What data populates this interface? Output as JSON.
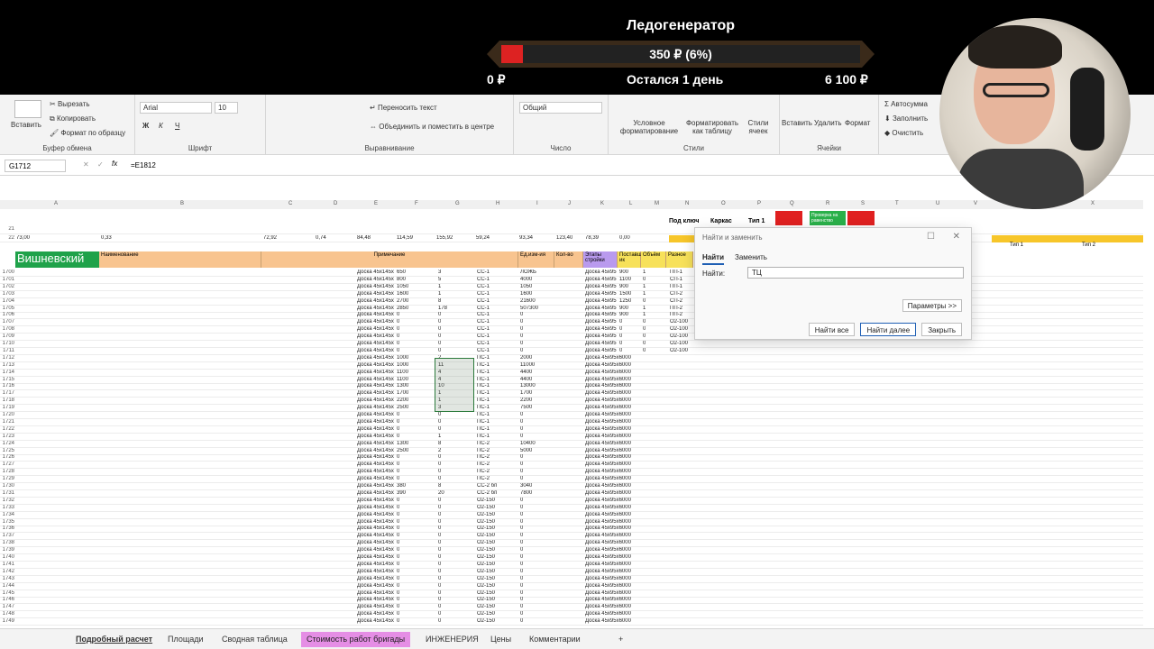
{
  "stream": {
    "title": "Ледогенератор",
    "progress_label": "350 ₽ (6%)",
    "progress_fraction": 0.06,
    "min_label": "0 ₽",
    "remaining_label": "Остался 1 день",
    "max_label": "6 100 ₽"
  },
  "ribbon": {
    "clipboard": {
      "paste": "Вставить",
      "cut": "Вырезать",
      "copy": "Копировать",
      "format_painter": "Формат по образцу",
      "label": "Буфер обмена"
    },
    "font": {
      "name": "Arial",
      "size": "10",
      "bold": "Ж",
      "italic": "К",
      "underline": "Ч",
      "label": "Шрифт"
    },
    "alignment": {
      "wrap": "Переносить текст",
      "merge": "Объединить и поместить в центре",
      "label": "Выравнивание"
    },
    "number": {
      "format": "Общий",
      "label": "Число"
    },
    "styles": {
      "cond": "Условное форматирование",
      "table": "Форматировать как таблицу",
      "cell": "Стили ячеек",
      "label": "Стили"
    },
    "cells": {
      "insert": "Вставить",
      "delete": "Удалить",
      "format": "Формат",
      "label": "Ячейки"
    },
    "editing": {
      "autosum": "Автосумма",
      "fill": "Заполнить",
      "clear": "Очистить"
    }
  },
  "formula_bar": {
    "cell": "G1712",
    "formula": "=E1812"
  },
  "columns": [
    "A",
    "B",
    "C",
    "D",
    "E",
    "F",
    "G",
    "H",
    "I",
    "J",
    "K",
    "L",
    "M",
    "N",
    "O",
    "P",
    "Q",
    "R",
    "S",
    "T",
    "U",
    "V",
    "X"
  ],
  "summary": {
    "row22": [
      "73,00",
      "0,33",
      "72,92",
      "0,74",
      "84,48",
      "114,59",
      "155,92",
      "59,24",
      "93,34",
      "123,40",
      "78,39",
      "0,00"
    ],
    "headers": [
      "Под ключ",
      "Каркас",
      "Тип 1",
      "Проверка на равенство",
      "Тип 1",
      "Тип 2"
    ]
  },
  "sheet": {
    "section_title": "Вишневский",
    "col_name": "Наименование",
    "col_note": "Примечание",
    "col_unit": "Ед.изм-ия",
    "col_qty": "Кол-во",
    "col_stage": "Этапы стройки",
    "col_supplier": "Поставщ ик",
    "col_volume": "Объём",
    "col_misc": "Разное"
  },
  "rows": [
    {
      "n": "1700",
      "e": "Доска 45х145х",
      "f": "650",
      "g": "3",
      "h": "СС-1",
      "i": "ЛОЖЬ",
      "k": "Доска 45х95",
      "l": "900",
      "m": "1",
      "n2": "ПП-1"
    },
    {
      "n": "1701",
      "e": "Доска 45х145х",
      "f": "800",
      "g": "5",
      "h": "СС-1",
      "i": "4000",
      "k": "Доска 45х95",
      "l": "1100",
      "m": "0",
      "n2": "СП-1"
    },
    {
      "n": "1702",
      "e": "Доска 45х145х",
      "f": "1050",
      "g": "1",
      "h": "СС-1",
      "i": "1050",
      "k": "Доска 45х95",
      "l": "900",
      "m": "1",
      "n2": "ПП-1"
    },
    {
      "n": "1703",
      "e": "Доска 45х145х",
      "f": "1600",
      "g": "1",
      "h": "СС-1",
      "i": "1600",
      "k": "Доска 45х95",
      "l": "1500",
      "m": "1",
      "n2": "СП-2"
    },
    {
      "n": "1704",
      "e": "Доска 45х145х",
      "f": "2700",
      "g": "8",
      "h": "СС-1",
      "i": "21600",
      "k": "Доска 45х95",
      "l": "1250",
      "m": "0",
      "n2": "СП-2"
    },
    {
      "n": "1705",
      "e": "Доска 45х145х",
      "f": "2850",
      "g": "178",
      "h": "СС-1",
      "i": "507300",
      "k": "Доска 45х95",
      "l": "900",
      "m": "1",
      "n2": "ПП-2"
    },
    {
      "n": "1706",
      "e": "Доска 45х145х",
      "f": "0",
      "g": "0",
      "h": "СС-1",
      "i": "0",
      "k": "Доска 45х95",
      "l": "900",
      "m": "1",
      "n2": "ПП-2"
    },
    {
      "n": "1707",
      "e": "Доска 45х145х",
      "f": "0",
      "g": "0",
      "h": "СС-1",
      "i": "0",
      "k": "Доска 45х95",
      "l": "0",
      "m": "0",
      "n2": "О2-100"
    },
    {
      "n": "1708",
      "e": "Доска 45х145х",
      "f": "0",
      "g": "0",
      "h": "СС-1",
      "i": "0",
      "k": "Доска 45х95",
      "l": "0",
      "m": "0",
      "n2": "О2-100"
    },
    {
      "n": "1709",
      "e": "Доска 45х145х",
      "f": "0",
      "g": "0",
      "h": "СС-1",
      "i": "0",
      "k": "Доска 45х95",
      "l": "0",
      "m": "0",
      "n2": "О2-100"
    },
    {
      "n": "1710",
      "e": "Доска 45х145х",
      "f": "0",
      "g": "0",
      "h": "СС-1",
      "i": "0",
      "k": "Доска 45х95",
      "l": "0",
      "m": "0",
      "n2": "О2-100"
    },
    {
      "n": "1711",
      "e": "Доска 45х145х",
      "f": "0",
      "g": "0",
      "h": "СС-1",
      "i": "0",
      "k": "Доска 45х95",
      "l": "0",
      "m": "0",
      "n2": "О2-100"
    },
    {
      "n": "1712",
      "e": "Доска 45х145х",
      "f": "1000",
      "g": "2",
      "h": "ПС-1",
      "i": "2000",
      "k": "Доска 45х95х6000",
      "l": "",
      "m": "",
      "n2": ""
    },
    {
      "n": "1713",
      "e": "Доска 45х145х",
      "f": "1000",
      "g": "11",
      "h": "ПС-1",
      "i": "11000",
      "k": "Доска 45х95х6000",
      "l": "",
      "m": "",
      "n2": ""
    },
    {
      "n": "1714",
      "e": "Доска 45х145х",
      "f": "1100",
      "g": "4",
      "h": "ПС-1",
      "i": "4400",
      "k": "Доска 45х95х6000",
      "l": "",
      "m": "",
      "n2": ""
    },
    {
      "n": "1715",
      "e": "Доска 45х145х",
      "f": "1100",
      "g": "4",
      "h": "ПС-1",
      "i": "4400",
      "k": "Доска 45х95х6000",
      "l": "",
      "m": "",
      "n2": ""
    },
    {
      "n": "1716",
      "e": "Доска 45х145х",
      "f": "1300",
      "g": "10",
      "h": "ПС-1",
      "i": "13000",
      "k": "Доска 45х95х6000",
      "l": "",
      "m": "",
      "n2": ""
    },
    {
      "n": "1717",
      "e": "Доска 45х145х",
      "f": "1700",
      "g": "1",
      "h": "ПС-1",
      "i": "1700",
      "k": "Доска 45х95х6000",
      "l": "",
      "m": "",
      "n2": ""
    },
    {
      "n": "1718",
      "e": "Доска 45х145х",
      "f": "2200",
      "g": "1",
      "h": "ПС-1",
      "i": "2200",
      "k": "Доска 45х95х6000",
      "l": "",
      "m": "",
      "n2": ""
    },
    {
      "n": "1719",
      "e": "Доска 45х145х",
      "f": "2500",
      "g": "3",
      "h": "ПС-1",
      "i": "7500",
      "k": "Доска 45х95х6000",
      "l": "",
      "m": "",
      "n2": ""
    },
    {
      "n": "1720",
      "e": "Доска 45х145х",
      "f": "0",
      "g": "0",
      "h": "ПС-1",
      "i": "0",
      "k": "Доска 45х95х6000",
      "l": "",
      "m": "",
      "n2": ""
    },
    {
      "n": "1721",
      "e": "Доска 45х145х",
      "f": "0",
      "g": "0",
      "h": "ПС-1",
      "i": "0",
      "k": "Доска 45х95х6000",
      "l": "",
      "m": "",
      "n2": ""
    },
    {
      "n": "1722",
      "e": "Доска 45х145х",
      "f": "0",
      "g": "0",
      "h": "ПС-1",
      "i": "0",
      "k": "Доска 45х95х6000",
      "l": "",
      "m": "",
      "n2": ""
    },
    {
      "n": "1723",
      "e": "Доска 45х145х",
      "f": "0",
      "g": "1",
      "h": "ПС-1",
      "i": "0",
      "k": "Доска 45х95х6000",
      "l": "",
      "m": "",
      "n2": ""
    },
    {
      "n": "1724",
      "e": "Доска 45х145х",
      "f": "1300",
      "g": "8",
      "h": "ПС-2",
      "i": "10400",
      "k": "Доска 45х95х6000",
      "l": "",
      "m": "",
      "n2": ""
    },
    {
      "n": "1725",
      "e": "Доска 45х145х",
      "f": "2500",
      "g": "2",
      "h": "ПС-2",
      "i": "5000",
      "k": "Доска 45х95х6000",
      "l": "",
      "m": "",
      "n2": ""
    },
    {
      "n": "1726",
      "e": "Доска 45х145х",
      "f": "0",
      "g": "0",
      "h": "ПС-2",
      "i": "0",
      "k": "Доска 45х95х6000",
      "l": "",
      "m": "",
      "n2": ""
    },
    {
      "n": "1727",
      "e": "Доска 45х145х",
      "f": "0",
      "g": "0",
      "h": "ПС-2",
      "i": "0",
      "k": "Доска 45х95х6000",
      "l": "",
      "m": "",
      "n2": ""
    },
    {
      "n": "1728",
      "e": "Доска 45х145х",
      "f": "0",
      "g": "0",
      "h": "ПС-2",
      "i": "0",
      "k": "Доска 45х95х6000",
      "l": "",
      "m": "",
      "n2": ""
    },
    {
      "n": "1729",
      "e": "Доска 45х145х",
      "f": "0",
      "g": "0",
      "h": "ПС-2",
      "i": "0",
      "k": "Доска 45х95х6000",
      "l": "",
      "m": "",
      "n2": ""
    },
    {
      "n": "1730",
      "e": "Доска 45х145х",
      "f": "380",
      "g": "8",
      "h": "СС-2 бп",
      "i": "3040",
      "k": "Доска 45х95х6000",
      "l": "",
      "m": "",
      "n2": ""
    },
    {
      "n": "1731",
      "e": "Доска 45х145х",
      "f": "390",
      "g": "20",
      "h": "СС-2 бп",
      "i": "7800",
      "k": "Доска 45х95х6000",
      "l": "",
      "m": "",
      "n2": ""
    },
    {
      "n": "1732",
      "e": "Доска 45х145х",
      "f": "0",
      "g": "0",
      "h": "О2-150",
      "i": "0",
      "k": "Доска 45х95х6000",
      "l": "",
      "m": "",
      "n2": ""
    },
    {
      "n": "1733",
      "e": "Доска 45х145х",
      "f": "0",
      "g": "0",
      "h": "О2-150",
      "i": "0",
      "k": "Доска 45х95х6000",
      "l": "",
      "m": "",
      "n2": ""
    },
    {
      "n": "1734",
      "e": "Доска 45х145х",
      "f": "0",
      "g": "0",
      "h": "О2-150",
      "i": "0",
      "k": "Доска 45х95х6000",
      "l": "",
      "m": "",
      "n2": ""
    },
    {
      "n": "1735",
      "e": "Доска 45х145х",
      "f": "0",
      "g": "0",
      "h": "О2-150",
      "i": "0",
      "k": "Доска 45х95х6000",
      "l": "",
      "m": "",
      "n2": ""
    },
    {
      "n": "1736",
      "e": "Доска 45х145х",
      "f": "0",
      "g": "0",
      "h": "О2-150",
      "i": "0",
      "k": "Доска 45х95х6000",
      "l": "",
      "m": "",
      "n2": ""
    },
    {
      "n": "1737",
      "e": "Доска 45х145х",
      "f": "0",
      "g": "0",
      "h": "О2-150",
      "i": "0",
      "k": "Доска 45х95х6000",
      "l": "",
      "m": "",
      "n2": ""
    },
    {
      "n": "1738",
      "e": "Доска 45х145х",
      "f": "0",
      "g": "0",
      "h": "О2-150",
      "i": "0",
      "k": "Доска 45х95х6000",
      "l": "",
      "m": "",
      "n2": ""
    },
    {
      "n": "1739",
      "e": "Доска 45х145х",
      "f": "0",
      "g": "0",
      "h": "О2-150",
      "i": "0",
      "k": "Доска 45х95х6000",
      "l": "",
      "m": "",
      "n2": ""
    },
    {
      "n": "1740",
      "e": "Доска 45х145х",
      "f": "0",
      "g": "0",
      "h": "О2-150",
      "i": "0",
      "k": "Доска 45х95х6000",
      "l": "",
      "m": "",
      "n2": ""
    },
    {
      "n": "1741",
      "e": "Доска 45х145х",
      "f": "0",
      "g": "0",
      "h": "О2-150",
      "i": "0",
      "k": "Доска 45х95х6000",
      "l": "",
      "m": "",
      "n2": ""
    },
    {
      "n": "1742",
      "e": "Доска 45х145х",
      "f": "0",
      "g": "0",
      "h": "О2-150",
      "i": "0",
      "k": "Доска 45х95х6000",
      "l": "",
      "m": "",
      "n2": ""
    },
    {
      "n": "1743",
      "e": "Доска 45х145х",
      "f": "0",
      "g": "0",
      "h": "О2-150",
      "i": "0",
      "k": "Доска 45х95х6000",
      "l": "",
      "m": "",
      "n2": ""
    },
    {
      "n": "1744",
      "e": "Доска 45х145х",
      "f": "0",
      "g": "0",
      "h": "О2-150",
      "i": "0",
      "k": "Доска 45х95х6000",
      "l": "",
      "m": "",
      "n2": ""
    },
    {
      "n": "1745",
      "e": "Доска 45х145х",
      "f": "0",
      "g": "0",
      "h": "О2-150",
      "i": "0",
      "k": "Доска 45х95х6000",
      "l": "",
      "m": "",
      "n2": ""
    },
    {
      "n": "1746",
      "e": "Доска 45х145х",
      "f": "0",
      "g": "0",
      "h": "О2-150",
      "i": "0",
      "k": "Доска 45х95х6000",
      "l": "",
      "m": "",
      "n2": ""
    },
    {
      "n": "1747",
      "e": "Доска 45х145х",
      "f": "0",
      "g": "0",
      "h": "О2-150",
      "i": "0",
      "k": "Доска 45х95х6000",
      "l": "",
      "m": "",
      "n2": ""
    },
    {
      "n": "1748",
      "e": "Доска 45х145х",
      "f": "0",
      "g": "0",
      "h": "О2-150",
      "i": "0",
      "k": "Доска 45х95х6000",
      "l": "",
      "m": "",
      "n2": ""
    },
    {
      "n": "1749",
      "e": "Доска 45х145х",
      "f": "0",
      "g": "0",
      "h": "О2-150",
      "i": "0",
      "k": "Доска 45х95х6000",
      "l": "",
      "m": "",
      "n2": ""
    }
  ],
  "dialog": {
    "title": "Найти и заменить",
    "tab_find": "Найти",
    "tab_replace": "Заменить",
    "find_label": "Найти:",
    "find_value": "ТЦ",
    "params": "Параметры >>",
    "find_all": "Найти все",
    "find_next": "Найти далее",
    "close": "Закрыть"
  },
  "sheet_tabs": [
    "Подробный расчет",
    "Площади",
    "Сводная таблица",
    "Стоимость работ бригады",
    "ИНЖЕНЕРИЯ",
    "Цены",
    "Комментарии"
  ],
  "colors": {
    "green": "#1fa24a",
    "orange": "#f8c48f",
    "pink": "#e58ee5",
    "accent": "#1f5fb4"
  }
}
